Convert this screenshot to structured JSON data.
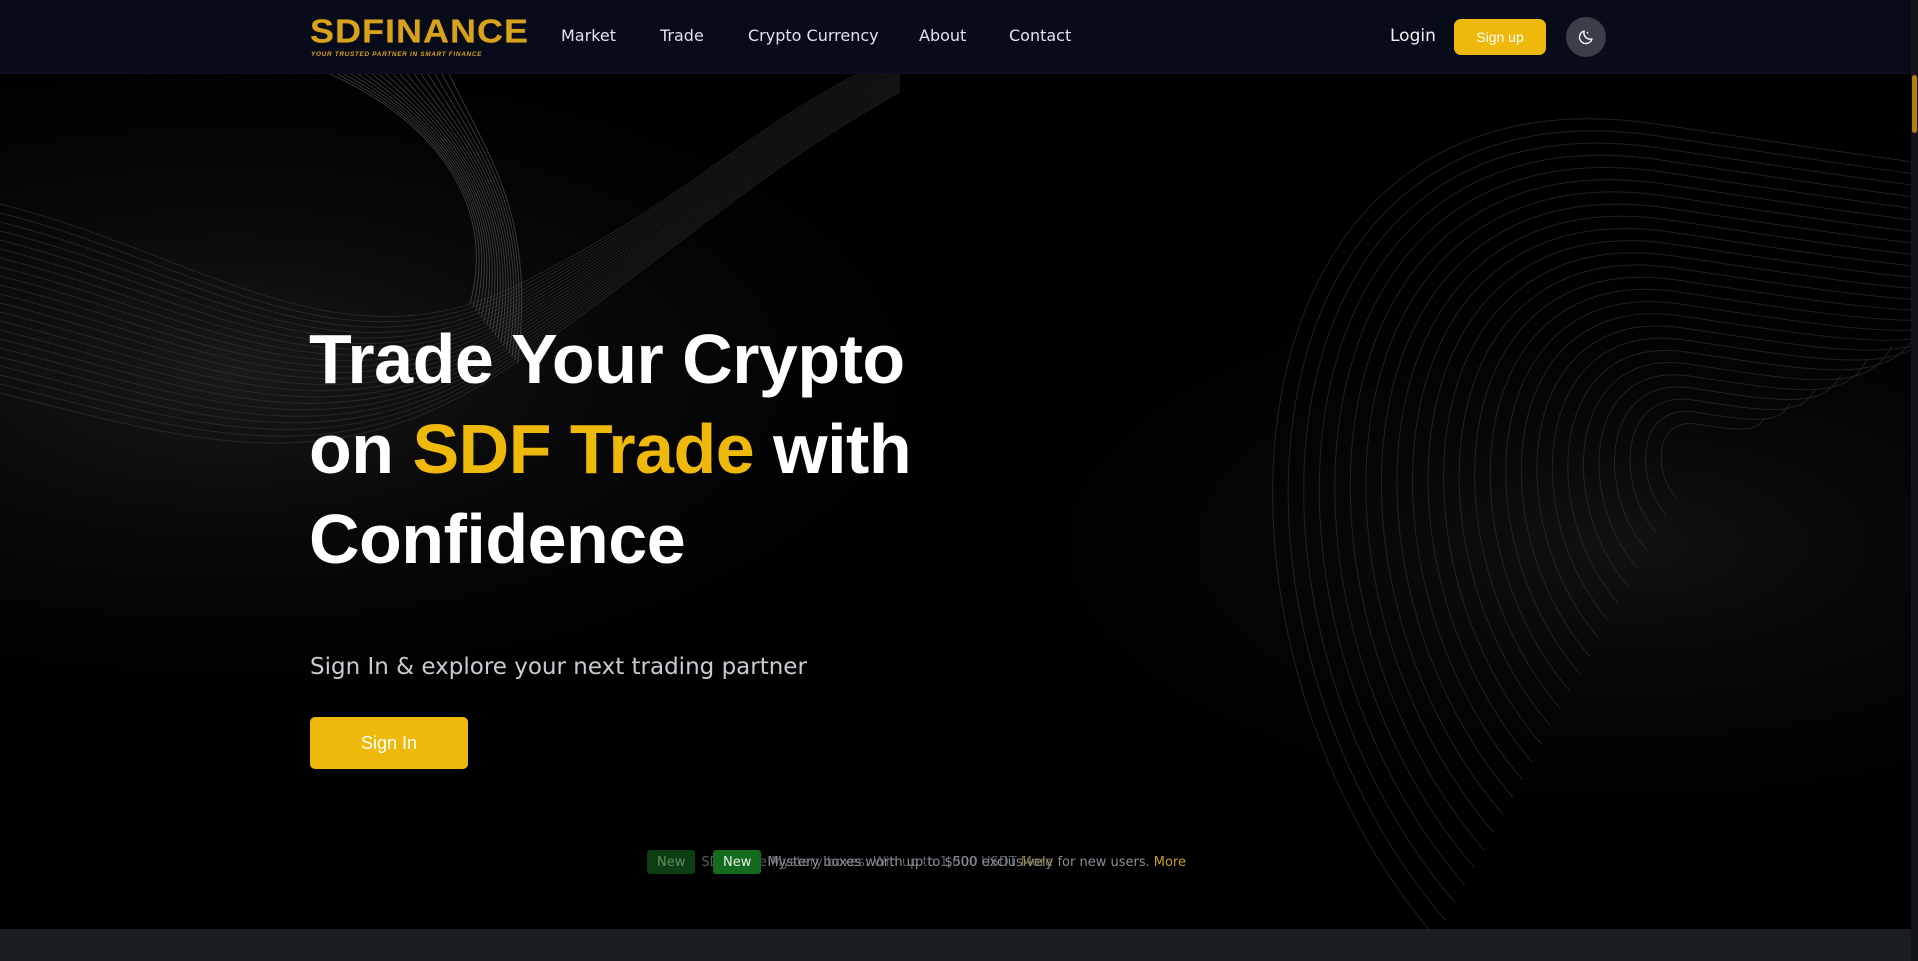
{
  "brand": {
    "logo_text": "SDFINANCE",
    "tagline": "YOUR TRUSTED PARTNER IN SMART FINANCE"
  },
  "nav": {
    "links": [
      "Market",
      "Trade",
      "Crypto Currency",
      "About",
      "Contact"
    ],
    "login_label": "Login",
    "signup_label": "Sign up",
    "theme_icon": "moon-icon"
  },
  "hero": {
    "title_part1": "Trade Your Crypto on ",
    "title_accent": "SDF Trade",
    "title_part2": " with Confidence",
    "subtitle": "Sign In & explore your next trading partner",
    "cta_label": "Sign In"
  },
  "announcements": [
    {
      "badge": "New",
      "text": "SDF Trade Mystery boxes: Win up to 1,000 USDT",
      "more": "More"
    },
    {
      "badge": "New",
      "text": "Mystery boxes worth up to $500 exclusively for new users.",
      "more": "More"
    }
  ],
  "colors": {
    "accent": "#efb90b",
    "nav_bg": "#080b1a",
    "badge_green": "#146a1e"
  }
}
